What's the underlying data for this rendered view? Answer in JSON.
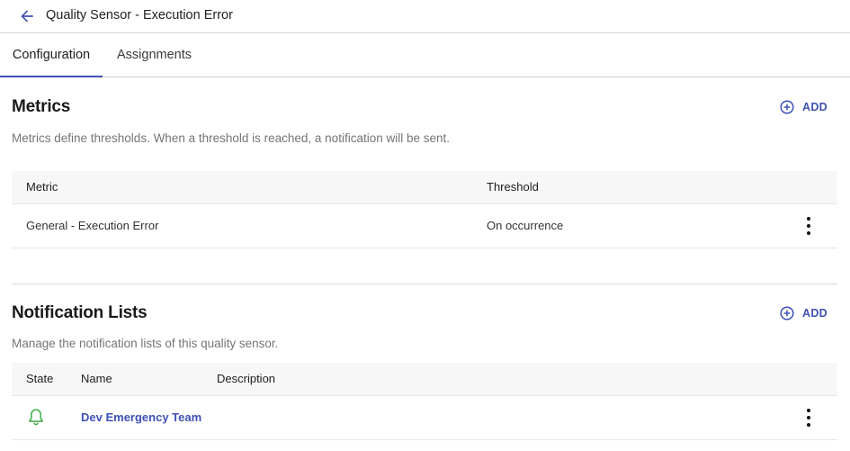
{
  "header": {
    "title": "Quality Sensor - Execution Error",
    "back_icon": "arrow-left-icon"
  },
  "tabs": [
    {
      "label": "Configuration",
      "active": true
    },
    {
      "label": "Assignments",
      "active": false
    }
  ],
  "metrics": {
    "title": "Metrics",
    "add_label": "ADD",
    "description": "Metrics define thresholds. When a threshold is reached, a notification will be sent.",
    "columns": [
      "Metric",
      "Threshold"
    ],
    "rows": [
      {
        "metric": "General - Execution Error",
        "threshold": "On occurrence"
      }
    ]
  },
  "notification_lists": {
    "title": "Notification Lists",
    "add_label": "ADD",
    "description": "Manage the notification lists of this quality sensor.",
    "columns": [
      "State",
      "Name",
      "Description"
    ],
    "rows": [
      {
        "state_icon": "bell-icon",
        "name": "Dev Emergency Team",
        "description": ""
      }
    ]
  },
  "colors": {
    "accent": "#3f51b5",
    "state_active": "#4caf50"
  }
}
